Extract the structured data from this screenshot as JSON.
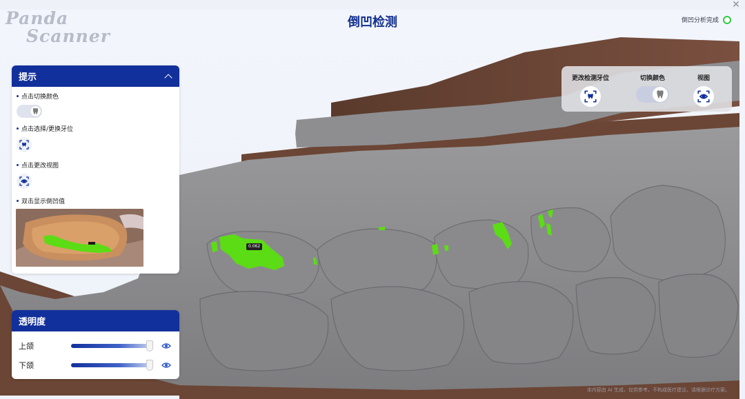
{
  "app": {
    "logo_line1": "Panda",
    "logo_line2": "Scanner",
    "title": "倒凹检测",
    "status_text": "倒凹分析完成",
    "close_glyph": "✕"
  },
  "hint_panel": {
    "title": "提示",
    "items": [
      {
        "label": "点击切换颜色",
        "icon": "tooth-toggle-icon"
      },
      {
        "label": "点击选择/更换牙位",
        "icon": "tooth-select-icon"
      },
      {
        "label": "点击更改视图",
        "icon": "eye-view-icon"
      },
      {
        "label": "双击显示倒凹值",
        "icon": "undercut-preview-image"
      }
    ]
  },
  "transparency_panel": {
    "title": "透明度",
    "rows": [
      {
        "label": "上颌",
        "value_fraction": 0.98
      },
      {
        "label": "下颌",
        "value_fraction": 0.98
      }
    ]
  },
  "toolbar": {
    "items": [
      {
        "label": "更改检测牙位",
        "icon": "tooth-select-icon"
      },
      {
        "label": "切换颜色",
        "icon": "tooth-toggle-icon"
      },
      {
        "label": "视图",
        "icon": "eye-view-icon"
      }
    ]
  },
  "model": {
    "undercut_value": "0.062"
  },
  "footer": {
    "disclaimer": "本内容由 AI 生成，仅供参考，不构成医疗建议，请根据诊疗方案。"
  },
  "colors": {
    "brand": "#12309b",
    "undercut": "#5cdc14",
    "status_ok": "#2ecc40",
    "gingiva": "#6b4535",
    "teeth": "#8c8c8e"
  }
}
